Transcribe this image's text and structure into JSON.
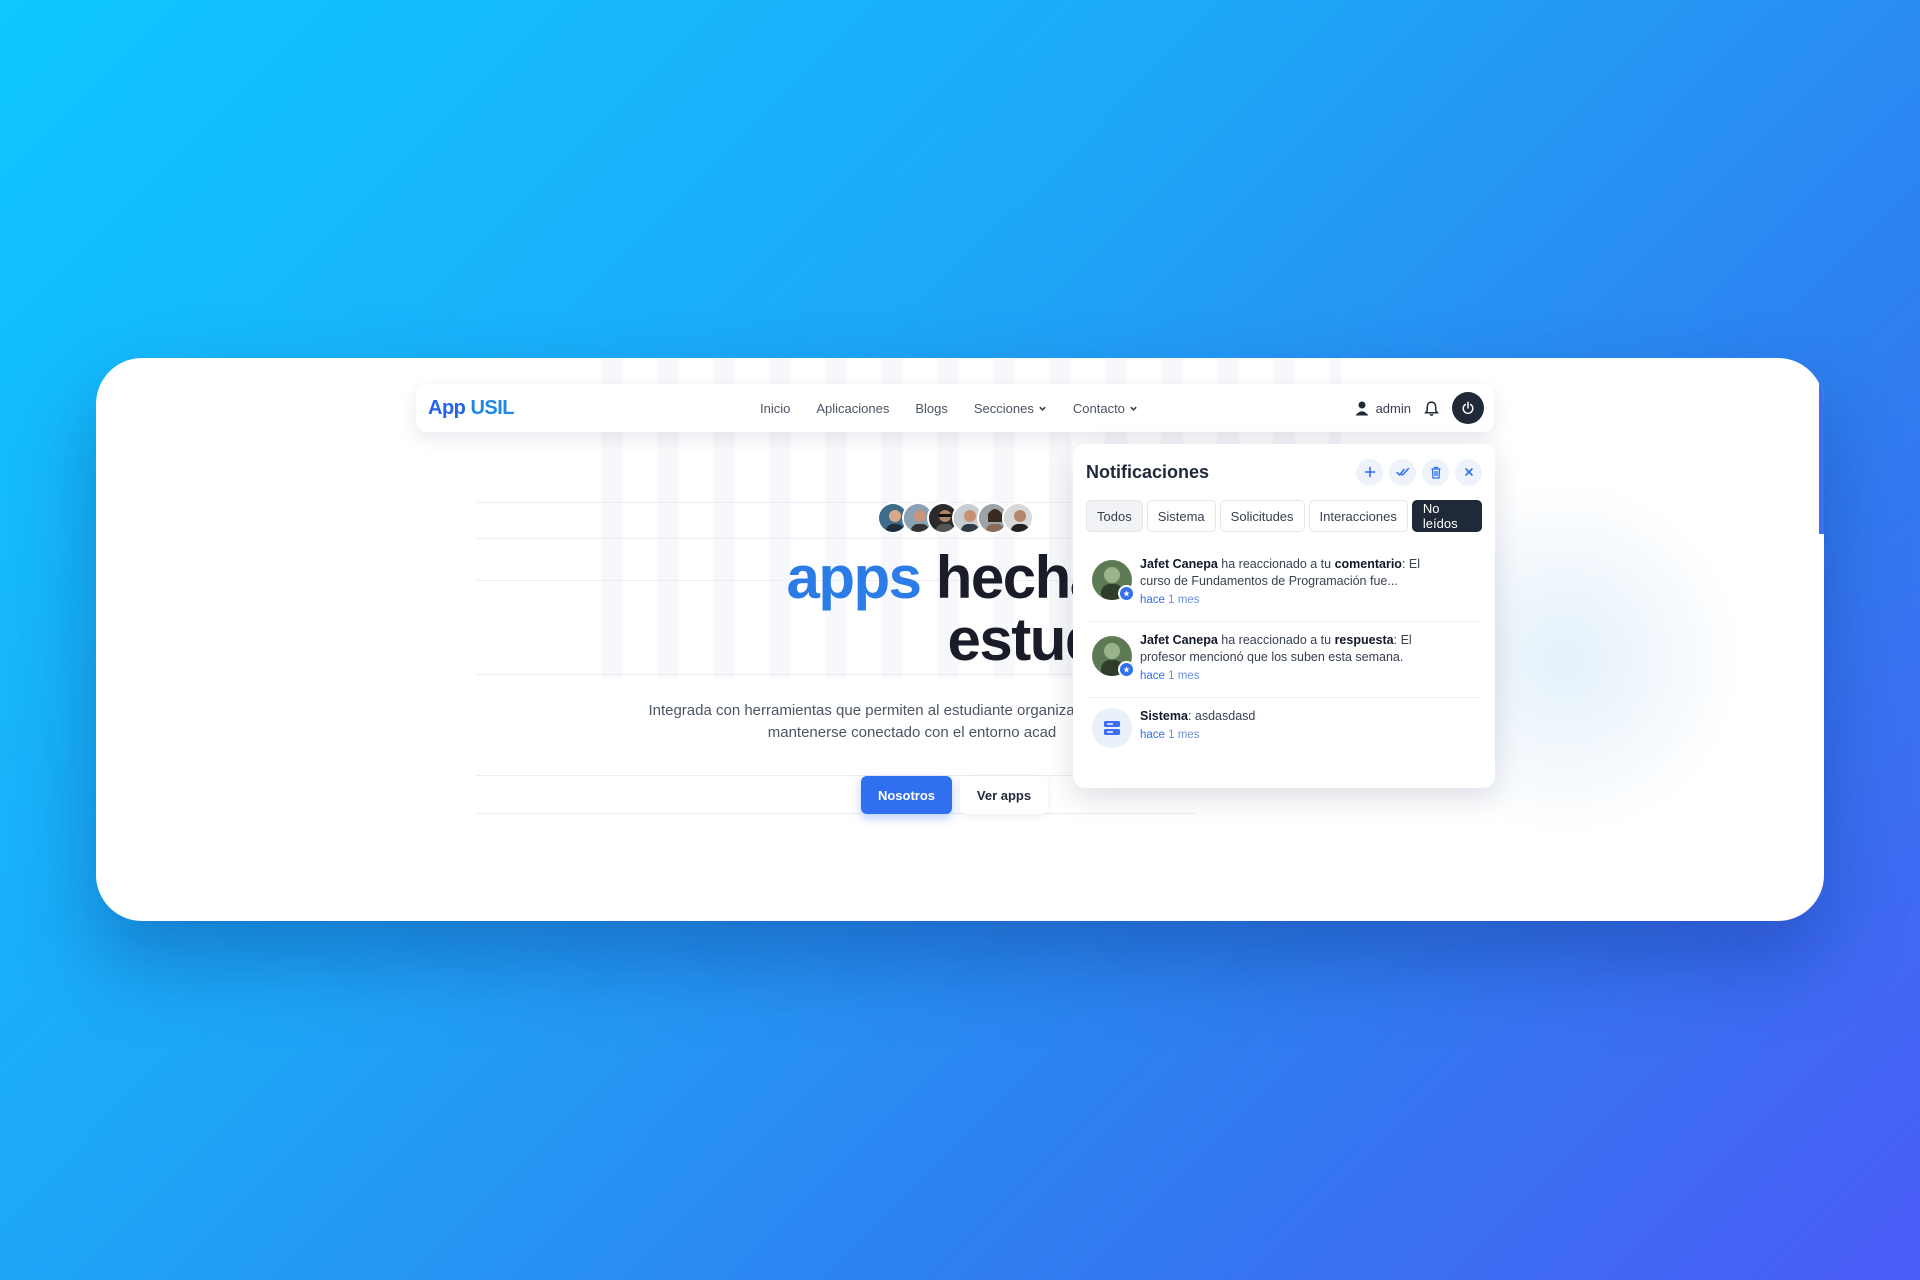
{
  "navbar": {
    "logo_app": "App",
    "logo_usil": "USIL",
    "links": [
      "Inicio",
      "Aplicaciones",
      "Blogs",
      "Secciones",
      "Contacto"
    ],
    "user": "admin"
  },
  "hero": {
    "headline_accent": "apps",
    "headline_rest": "hechas",
    "headline_line2": "estudiante",
    "subtitle_line1": "Integrada con herramientas que permiten al estudiante organizar",
    "subtitle_line2": "mantenerse conectado con el entorno acad",
    "btn_primary": "Nosotros",
    "btn_secondary": "Ver apps"
  },
  "notifications": {
    "title": "Notificaciones",
    "tabs": [
      "Todos",
      "Sistema",
      "Solicitudes",
      "Interacciones",
      "No leídos"
    ],
    "items": [
      {
        "name": "Jafet Canepa",
        "action": " ha reaccionado a tu ",
        "target": "comentario",
        "text": ": El curso de Fundamentos de Programación fue...",
        "time_a": "hace",
        "time_b": "1 mes"
      },
      {
        "name": "Jafet Canepa",
        "action": " ha reaccionado a tu ",
        "target": "respuesta",
        "text": ": El profesor mencionó que los suben esta semana.",
        "time_a": "hace",
        "time_b": "1 mes"
      },
      {
        "name": "Sistema",
        "action": ": asdasdasd",
        "target": "",
        "text": "",
        "time_a": "hace",
        "time_b": "1 mes"
      }
    ]
  },
  "colors": {
    "brand": "#2563eb",
    "accent": "#2b7ce6",
    "dark": "#1f2937"
  },
  "icons": [
    "user-icon",
    "bell-icon",
    "power-icon",
    "plus-icon",
    "check-double-icon",
    "trash-icon",
    "close-icon",
    "chevron-down-icon",
    "reaction-badge-icon",
    "server-icon"
  ]
}
